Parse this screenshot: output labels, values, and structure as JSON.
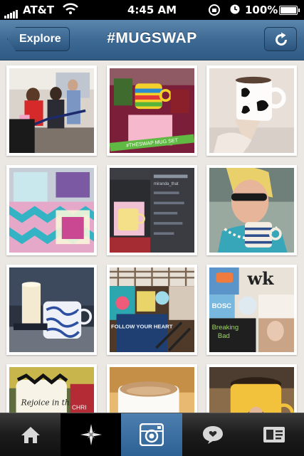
{
  "status_bar": {
    "carrier": "AT&T",
    "time": "4:45 AM",
    "battery": "100%"
  },
  "nav": {
    "back_label": "Explore",
    "title": "#MUGSWAP"
  },
  "grid": {
    "photo_text": {
      "banner": "#THESWAP MUG SET",
      "post_user": "miranda_that",
      "book_title": "FOLLOW YOUR HEART",
      "collage_wk": "wk",
      "collage_bosc": "BOSC",
      "collage_breaking": "Breaking",
      "collage_bad": "Bad",
      "mug_text": "Rejoice in this Day",
      "chris": "CHRI"
    }
  },
  "tabbar": {
    "tabs": [
      "home-tab",
      "explore-tab",
      "camera-tab",
      "news-tab",
      "profile-tab"
    ],
    "active_tab": "camera-tab"
  },
  "colors": {
    "nav": "#3d6a94",
    "tab_active": "#3d72a6",
    "background": "#ebe8e3"
  }
}
